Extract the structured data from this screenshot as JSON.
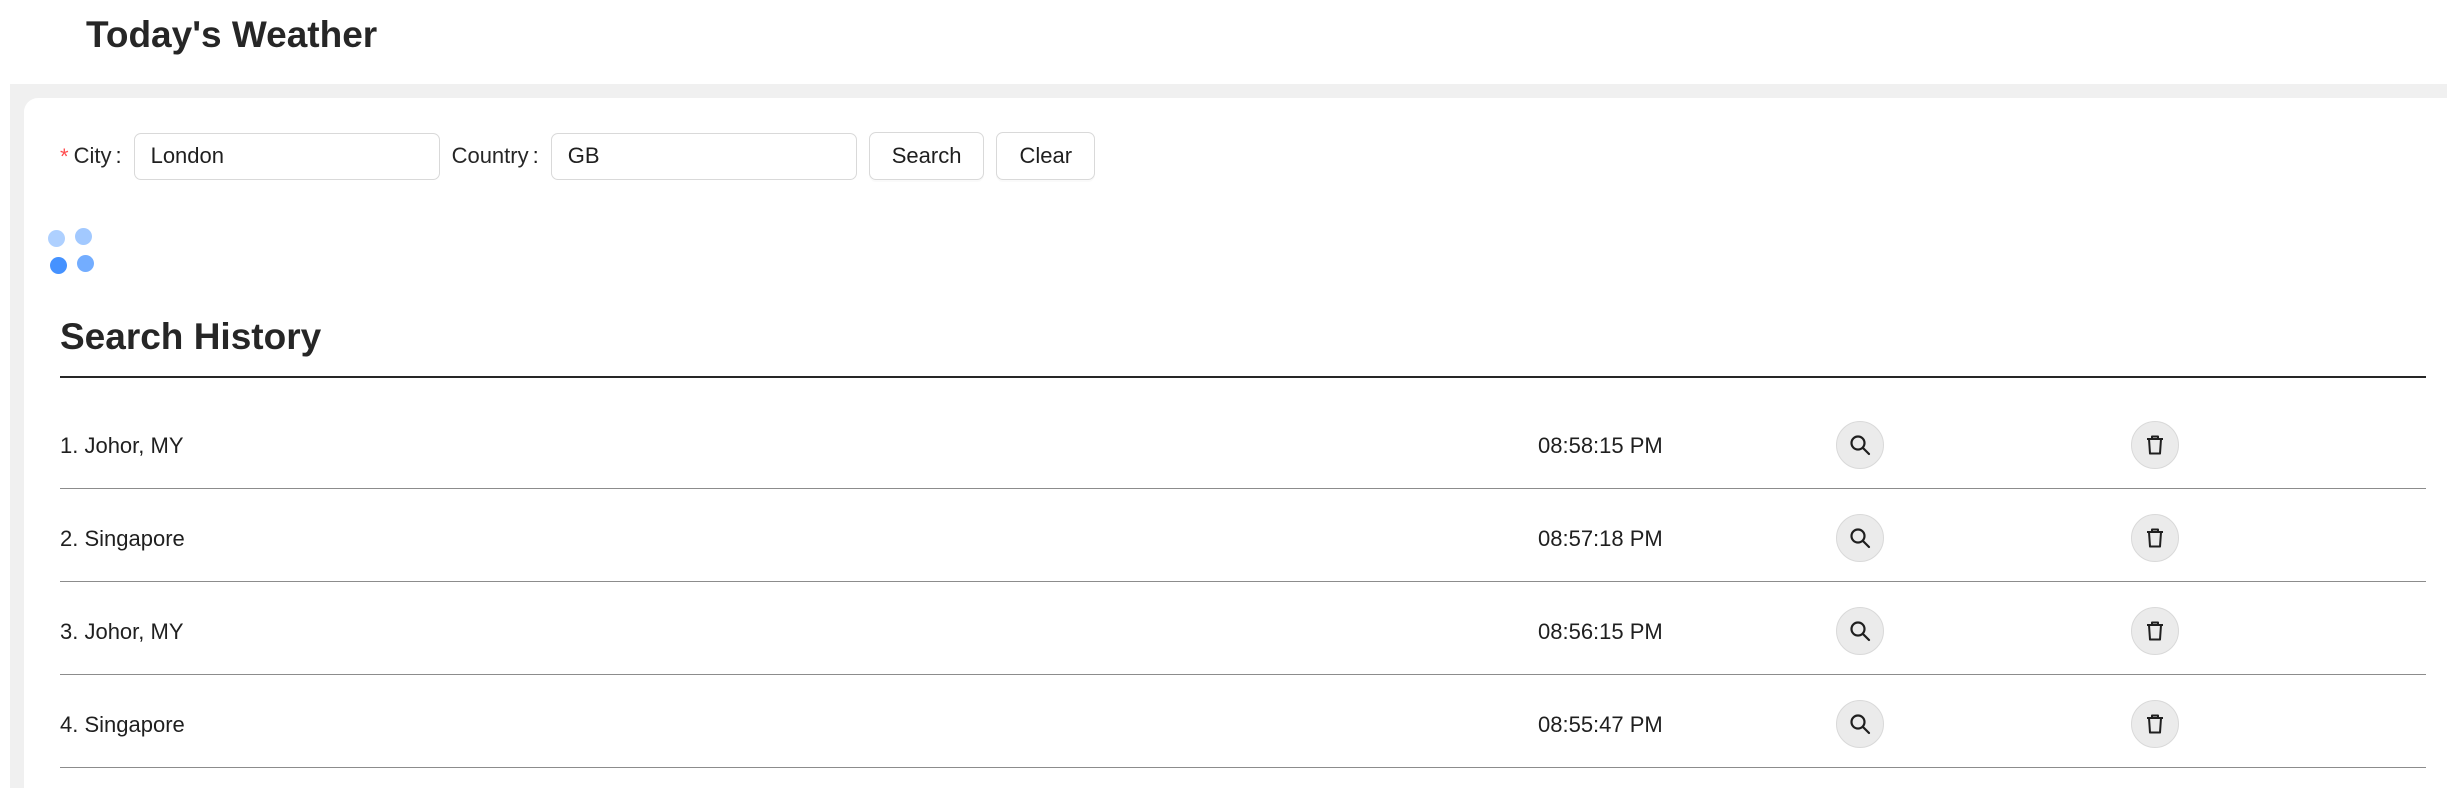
{
  "header": {
    "title": "Today's Weather"
  },
  "form": {
    "required_mark": "*",
    "city_label": "City",
    "city_value": "London",
    "country_label": "Country",
    "country_value": "GB",
    "search_label": "Search",
    "clear_label": "Clear"
  },
  "history": {
    "title": "Search History",
    "items": [
      {
        "label": "1. Johor, MY",
        "time": "08:58:15 PM"
      },
      {
        "label": "2. Singapore",
        "time": "08:57:18 PM"
      },
      {
        "label": "3. Johor, MY",
        "time": "08:56:15 PM"
      },
      {
        "label": "4. Singapore",
        "time": "08:55:47 PM"
      }
    ],
    "row_actions": [
      "search-icon",
      "trash-icon"
    ]
  },
  "colors": {
    "accent": "#1677ff",
    "required": "#ff4d4f",
    "background": "#f0f0f0"
  }
}
